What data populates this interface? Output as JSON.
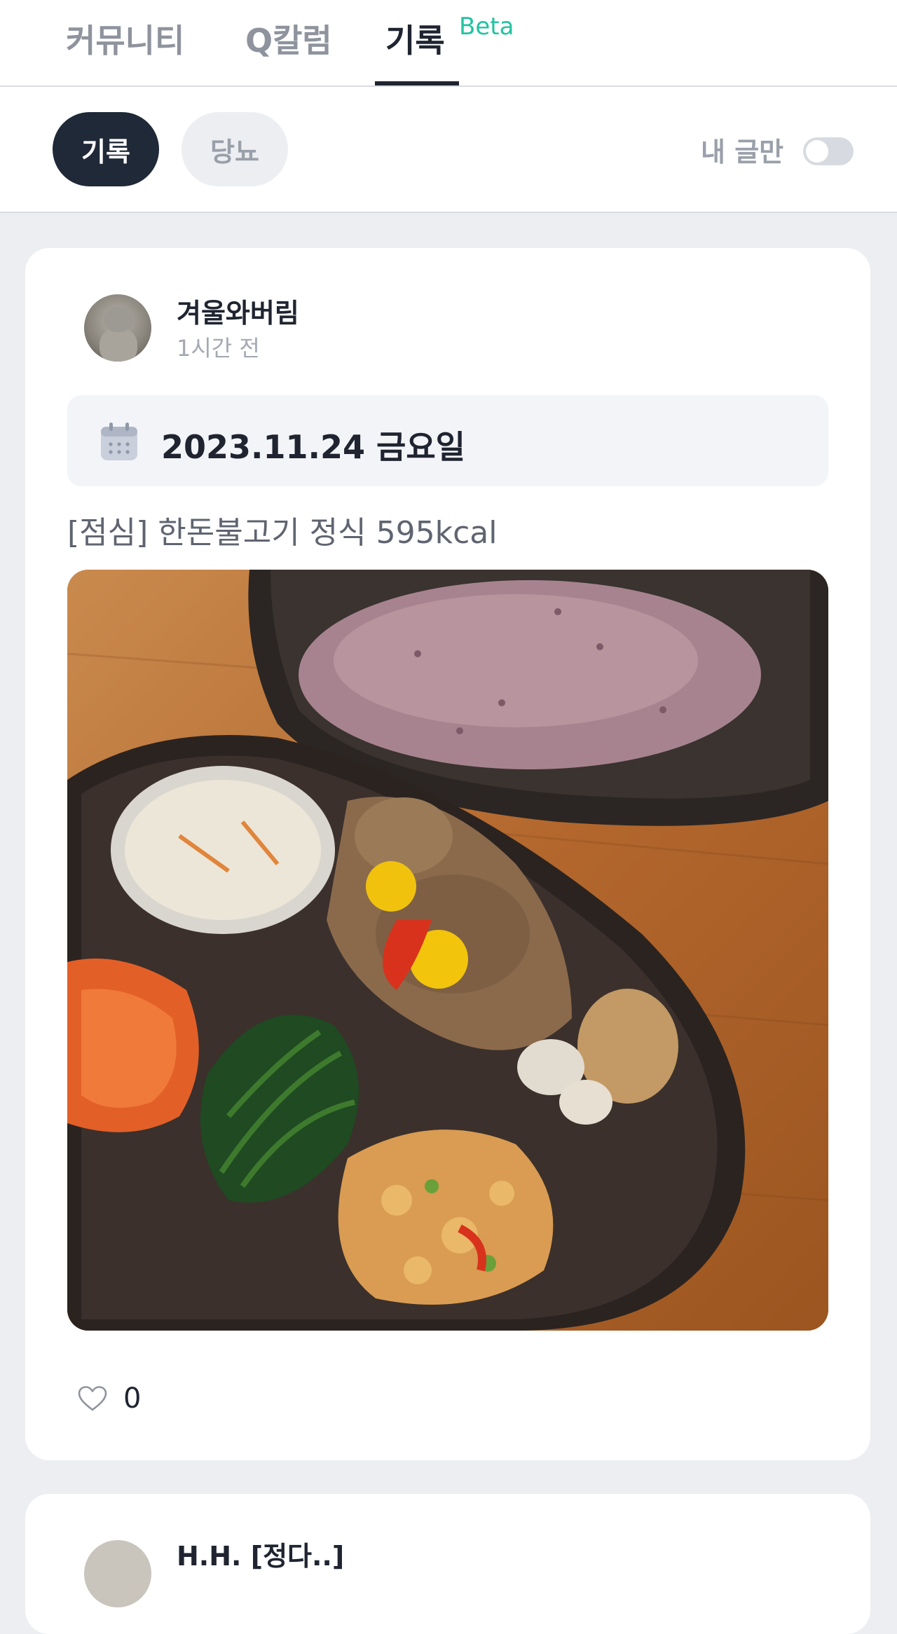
{
  "tabs": {
    "community": "커뮤니티",
    "column": "Q칼럼",
    "record": "기록",
    "beta": "Beta"
  },
  "filters": {
    "record_chip": "기록",
    "diabetes_chip": "당뇨",
    "mine_only_label": "내 글만",
    "mine_only_on": false
  },
  "post": {
    "username": "겨울와버림",
    "time": "1시간 전",
    "date": "2023.11.24 금요일",
    "meal": "[점심] 한돈불고기 정식 595kcal",
    "likes": "0"
  },
  "next_post": {
    "username": "H.H. [정다..]"
  },
  "colors": {
    "accent": "#22c3a0",
    "dark": "#1f2937"
  }
}
